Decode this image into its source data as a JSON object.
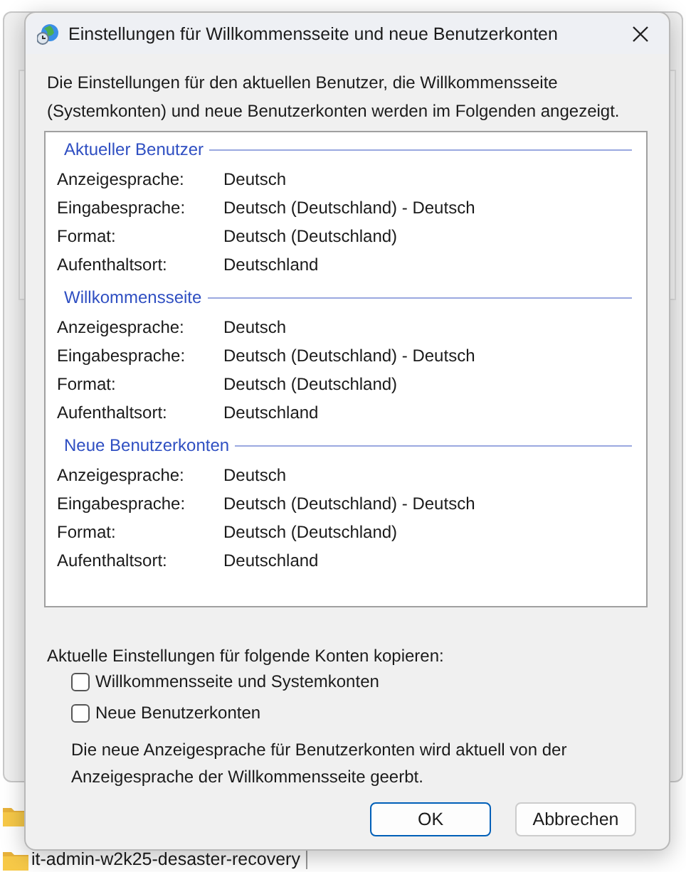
{
  "background": {
    "file_item": "it-admin-w2k25-desaster-recovery"
  },
  "dialog": {
    "title": "Einstellungen für Willkommensseite und neue Benutzerkonten",
    "intro": "Die Einstellungen für den aktuellen Benutzer, die Willkommensseite (Systemkonten) und neue Benutzerkonten werden im Folgenden angezeigt.",
    "sections": [
      {
        "heading": "Aktueller Benutzer",
        "rows": [
          {
            "label": "Anzeigesprache:",
            "value": "Deutsch"
          },
          {
            "label": "Eingabesprache:",
            "value": "Deutsch (Deutschland) - Deutsch"
          },
          {
            "label": "Format:",
            "value": "Deutsch (Deutschland)"
          },
          {
            "label": "Aufenthaltsort:",
            "value": "Deutschland"
          }
        ]
      },
      {
        "heading": "Willkommensseite",
        "rows": [
          {
            "label": "Anzeigesprache:",
            "value": "Deutsch"
          },
          {
            "label": "Eingabesprache:",
            "value": "Deutsch (Deutschland) - Deutsch"
          },
          {
            "label": "Format:",
            "value": "Deutsch (Deutschland)"
          },
          {
            "label": "Aufenthaltsort:",
            "value": "Deutschland"
          }
        ]
      },
      {
        "heading": "Neue Benutzerkonten",
        "rows": [
          {
            "label": "Anzeigesprache:",
            "value": "Deutsch"
          },
          {
            "label": "Eingabesprache:",
            "value": "Deutsch (Deutschland) - Deutsch"
          },
          {
            "label": "Format:",
            "value": "Deutsch (Deutschland)"
          },
          {
            "label": "Aufenthaltsort:",
            "value": "Deutschland"
          }
        ]
      }
    ],
    "copy_label": "Aktuelle Einstellungen für folgende Konten kopieren:",
    "checkboxes": [
      {
        "label": "Willkommensseite und Systemkonten",
        "checked": false
      },
      {
        "label": "Neue Benutzerkonten",
        "checked": false
      }
    ],
    "note": "Die neue Anzeigesprache für Benutzerkonten wird aktuell von der Anzeigesprache der Willkommensseite geerbt.",
    "buttons": [
      {
        "label": "OK",
        "default": true
      },
      {
        "label": "Abbrechen",
        "default": false
      }
    ]
  }
}
